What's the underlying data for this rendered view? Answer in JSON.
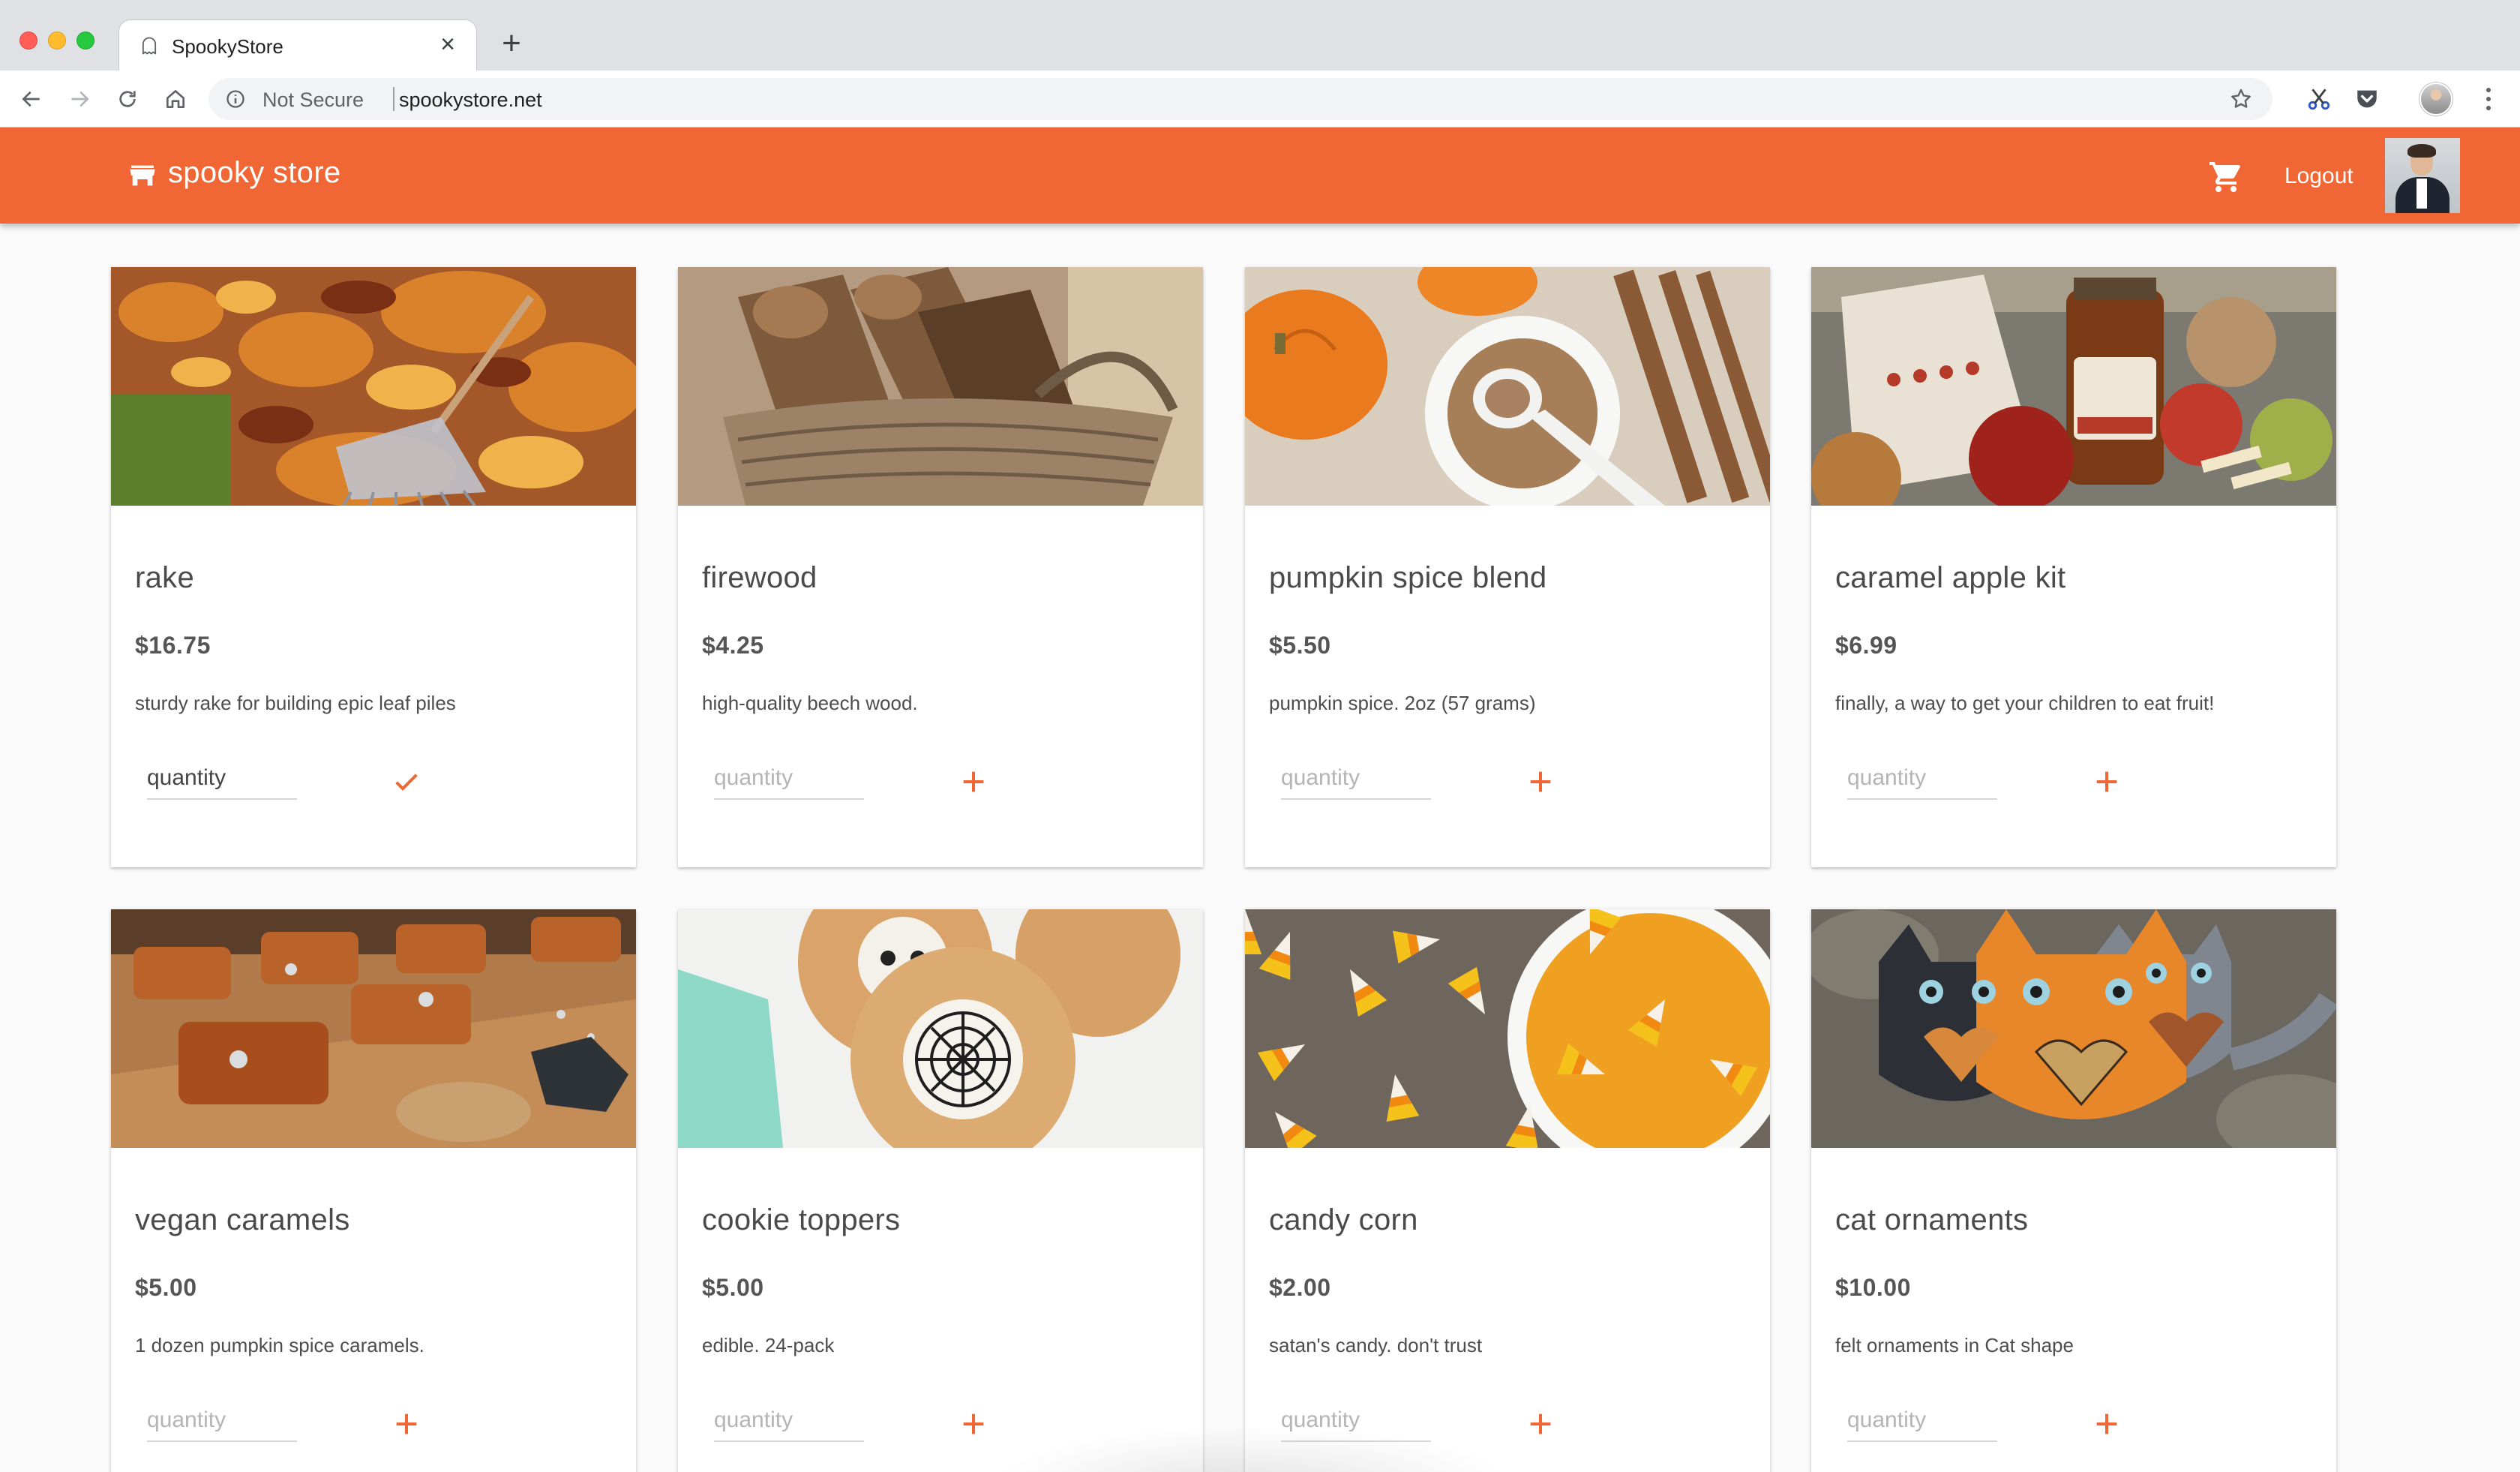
{
  "browser": {
    "tab_title": "SpookyStore",
    "tab_close_glyph": "×",
    "new_tab_glyph": "+",
    "security_label": "Not Secure",
    "url": "spookystore.net"
  },
  "appbar": {
    "brand": "spooky store",
    "logout_label": "Logout",
    "accent_color": "#f06634"
  },
  "products": [
    {
      "title": "rake",
      "price": "$16.75",
      "description": "sturdy rake for building epic leaf piles",
      "quantity_placeholder": "quantity",
      "action_icon": "check-icon"
    },
    {
      "title": "firewood",
      "price": "$4.25",
      "description": "high-quality beech wood.",
      "quantity_placeholder": "quantity",
      "action_icon": "plus-icon"
    },
    {
      "title": "pumpkin spice blend",
      "price": "$5.50",
      "description": "pumpkin spice. 2oz (57 grams)",
      "quantity_placeholder": "quantity",
      "action_icon": "plus-icon"
    },
    {
      "title": "caramel apple kit",
      "price": "$6.99",
      "description": "finally, a way to get your children to eat fruit!",
      "quantity_placeholder": "quantity",
      "action_icon": "plus-icon"
    },
    {
      "title": "vegan caramels",
      "price": "$5.00",
      "description": "1 dozen pumpkin spice caramels.",
      "quantity_placeholder": "quantity",
      "action_icon": "plus-icon"
    },
    {
      "title": "cookie toppers",
      "price": "$5.00",
      "description": "edible. 24-pack",
      "quantity_placeholder": "quantity",
      "action_icon": "plus-icon"
    },
    {
      "title": "candy corn",
      "price": "$2.00",
      "description": "satan's candy. don't trust",
      "quantity_placeholder": "quantity",
      "action_icon": "plus-icon"
    },
    {
      "title": "cat ornaments",
      "price": "$10.00",
      "description": "felt ornaments in Cat shape",
      "quantity_placeholder": "quantity",
      "action_icon": "plus-icon"
    }
  ]
}
